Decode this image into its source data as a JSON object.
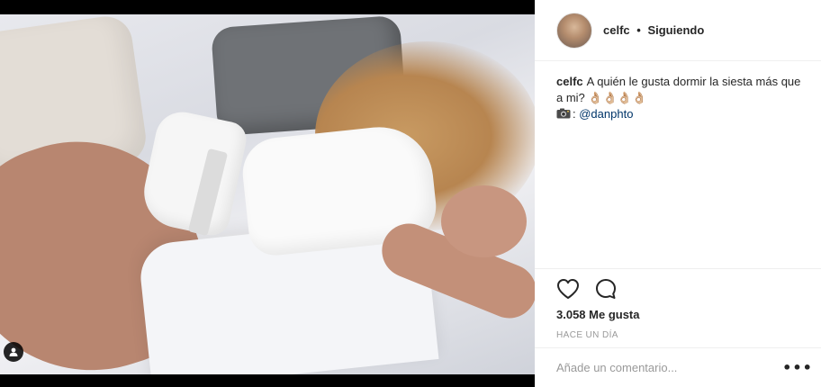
{
  "post": {
    "username": "celfc",
    "follow_status": "Siguiendo",
    "separator": "•"
  },
  "caption": {
    "username": "celfc",
    "text": "A quién le gusta dormir la siesta más que a mi? ",
    "emojis": "👌🏼👌🏼👌🏼👌🏼",
    "camera_icon": "camera-icon",
    "mention": "@danphto"
  },
  "stats": {
    "likes": "3.058 Me gusta",
    "time": "HACE UN DÍA"
  },
  "comment": {
    "placeholder": "Añade un comentario...",
    "more_label": "•••"
  },
  "icons": {
    "like": "heart-icon",
    "comment": "comment-icon",
    "user_tag": "user-icon"
  }
}
